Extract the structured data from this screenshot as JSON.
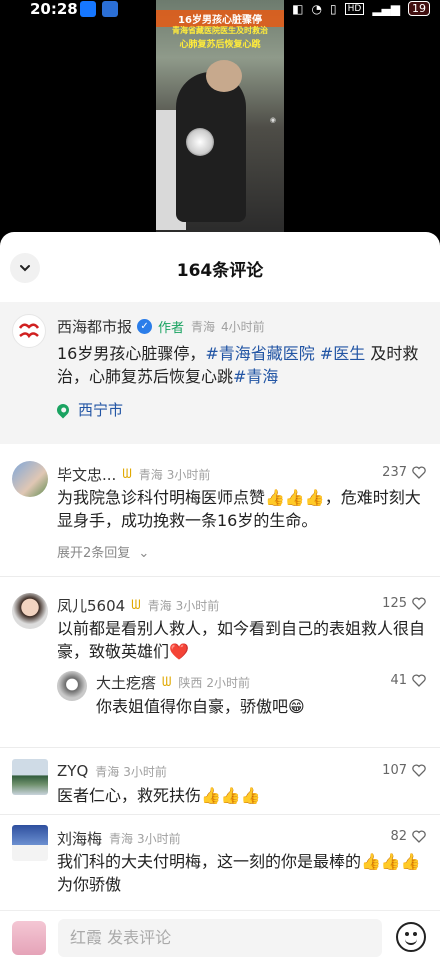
{
  "status_bar": {
    "time": "20:28",
    "battery": "19"
  },
  "video": {
    "caption_line1": "16岁男孩心脏骤停",
    "caption_line2": "青海省藏医院医生及时救治",
    "caption_line3": "心肺复苏后恢复心跳"
  },
  "sheet": {
    "title": "164条评论"
  },
  "post": {
    "author": "西海都市报",
    "author_tag": "作者",
    "location": "青海",
    "time": "4小时前",
    "text_plain1": "16岁男孩心脏骤停，",
    "tag1": "#青海省藏医院",
    "tag2": "#医生",
    "text_plain2": " 及时救治，心肺复苏后恢复心跳",
    "tag3": "#青海",
    "place": "西宁市",
    "avatar_text": "西海都市报"
  },
  "comments": [
    {
      "name": "毕文忠...",
      "location": "青海",
      "time": "3小时前",
      "likes": "237",
      "text": "为我院急诊科付明梅医师点赞👍👍👍，危难时刻大显身手，成功挽救一条16岁的生命。",
      "replies_toggle": "展开2条回复"
    },
    {
      "name": "凤儿5604",
      "location": "青海",
      "time": "3小时前",
      "likes": "125",
      "text": "以前都是看别人救人，如今看到自己的表姐救人很自豪，致敬英雄们❤️",
      "reply": {
        "name": "大土疙瘩",
        "location": "陕西",
        "time": "2小时前",
        "likes": "41",
        "text": "你表姐值得你自豪，骄傲吧😁"
      }
    },
    {
      "name": "ZYQ",
      "location": "青海",
      "time": "3小时前",
      "likes": "107",
      "text": "医者仁心，救死扶伤👍👍👍"
    },
    {
      "name": "刘海梅",
      "location": "青海",
      "time": "3小时前",
      "likes": "82",
      "text": "我们科的大夫付明梅，这一刻的你是最棒的👍👍👍为你骄傲"
    }
  ],
  "footer": {
    "placeholder": "红霞 发表评论"
  },
  "colors": {
    "tag": "#2255a4",
    "author": "#1aa361",
    "badge": "#e0a800"
  }
}
